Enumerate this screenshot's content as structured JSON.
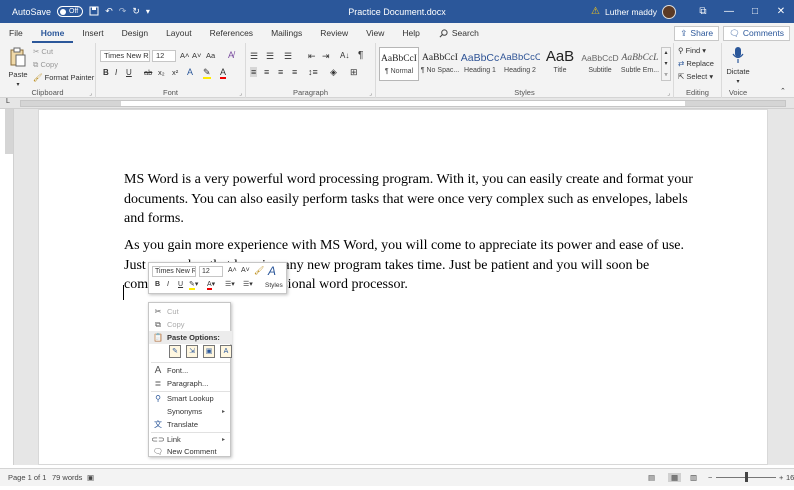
{
  "titlebar": {
    "autosave_label": "AutoSave",
    "autosave_state": "Off",
    "doc_title": "Practice Document.docx",
    "user_name": "Luther maddy",
    "restore_icon": "⧉",
    "minimize_icon": "—",
    "maximize_icon": "□"
  },
  "tabs": {
    "items": [
      "File",
      "Home",
      "Insert",
      "Design",
      "Layout",
      "References",
      "Mailings",
      "Review",
      "View",
      "Help"
    ],
    "search_label": "Search",
    "share_label": "Share",
    "comments_label": "Comments"
  },
  "ribbon": {
    "clipboard": {
      "paste": "Paste",
      "cut": "Cut",
      "copy": "Copy",
      "format_painter": "Format Painter",
      "label": "Clipboard"
    },
    "font": {
      "font_name": "Times New Ro",
      "font_size": "12",
      "grow": "A˄",
      "shrink": "A˅",
      "change_case": "Aa",
      "label": "Font",
      "bold": "B",
      "italic": "I",
      "underline": "U",
      "strike": "ab",
      "subscript": "x₂",
      "superscript": "x²"
    },
    "paragraph": {
      "label": "Paragraph",
      "pilcrow": "¶"
    },
    "styles": {
      "label": "Styles",
      "items": [
        {
          "sample": "AaBbCcI",
          "name": "¶ Normal"
        },
        {
          "sample": "AaBbCcI",
          "name": "¶ No Spac..."
        },
        {
          "sample": "AaBbCc",
          "name": "Heading 1"
        },
        {
          "sample": "AaBbCcC",
          "name": "Heading 2"
        },
        {
          "sample": "AaB",
          "name": "Title"
        },
        {
          "sample": "AaBbCcD",
          "name": "Subtitle"
        },
        {
          "sample": "AaBbCcL",
          "name": "Subtle Em..."
        }
      ]
    },
    "editing": {
      "find": "Find",
      "replace": "Replace",
      "select": "Select",
      "label": "Editing"
    },
    "voice": {
      "dictate": "Dictate",
      "label": "Voice"
    }
  },
  "document": {
    "paragraph1": "MS Word is a very powerful word processing program.  With it, you can easily create and format your documents.  You can also easily perform tasks that were once very complex such as envelopes, labels and forms.",
    "paragraph2": "As you gain more experience with MS Word, you will come to appreciate its power and ease of use.  Just remember that learning any new program takes time.  Just be patient and you will soon be comfortable with this professional word processor."
  },
  "minitoolbar": {
    "font_name": "Times New Rc",
    "font_size": "12",
    "grow": "A˄",
    "shrink": "A˅",
    "styles": "Styles",
    "bold": "B",
    "italic": "I",
    "underline": "U"
  },
  "context_menu": {
    "cut": "Cut",
    "copy": "Copy",
    "paste_options": "Paste Options:",
    "font": "Font...",
    "paragraph": "Paragraph...",
    "smart_lookup": "Smart Lookup",
    "synonyms": "Synonyms",
    "translate": "Translate",
    "link": "Link",
    "new_comment": "New Comment"
  },
  "statusbar": {
    "page": "Page 1 of 1",
    "words": "79 words",
    "zoom": "16",
    "zoom_minus": "−",
    "zoom_plus": "+"
  },
  "colors": {
    "accent": "#2b579a",
    "ribbon_bg": "#f3f3f3",
    "doc_bg": "#e6e6e6"
  }
}
